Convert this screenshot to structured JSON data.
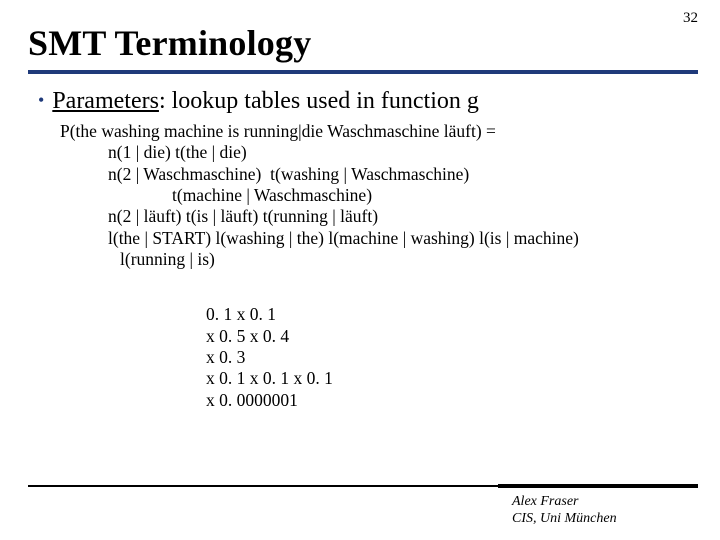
{
  "page_number": "32",
  "title": "SMT Terminology",
  "bullet": {
    "parameters_label": "Parameters",
    "rest": ": lookup tables used in function g"
  },
  "formula": {
    "l1": "P(the washing machine is running|die Waschmaschine läuft) =",
    "l2": "n(1 | die) t(the | die)",
    "l3": "n(2 | Waschmaschine)  t(washing | Waschmaschine)",
    "l4": "t(machine | Waschmaschine)",
    "l5": "n(2 | läuft) t(is | läuft) t(running | läuft)",
    "l6": "l(the | START) l(washing | the) l(machine | washing) l(is | machine)",
    "l7": "l(running | is)"
  },
  "numbers": {
    "n1": "0. 1 x 0. 1",
    "n2": "x 0. 5 x 0. 4",
    "n3": "x 0. 3",
    "n4": "x 0. 1 x 0. 1 x 0. 1",
    "n5": "x 0. 0000001"
  },
  "author": {
    "name": "Alex Fraser",
    "affil": "CIS, Uni München"
  }
}
